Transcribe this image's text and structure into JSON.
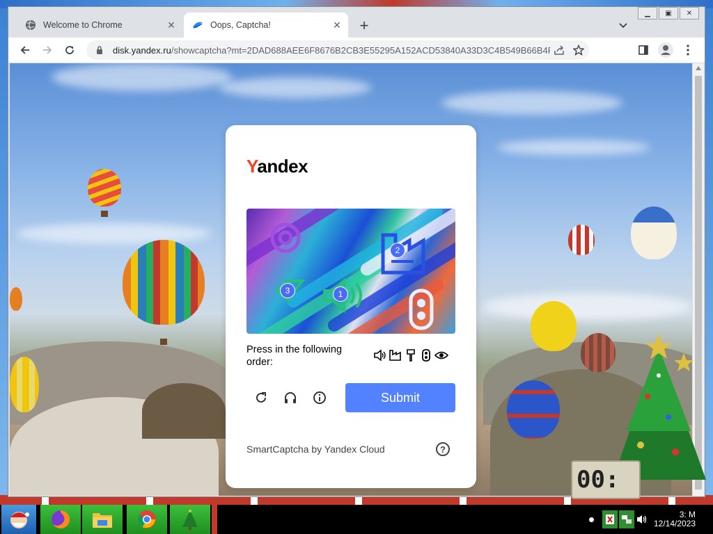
{
  "browser": {
    "tabs": [
      {
        "title": "Welcome to Chrome",
        "active": false
      },
      {
        "title": "Oops, Captcha!",
        "active": true
      }
    ],
    "address": {
      "host": "disk.yandex.ru",
      "path": "/showcaptcha?mt=2DAD688AEE6F8676B2CB3E55295A152ACD53840A33D3C4B549B66B4F07..."
    }
  },
  "captcha": {
    "logo_first": "Y",
    "logo_rest": "andex",
    "instruction": "Press in the following order:",
    "order_icons": [
      "speaker-icon",
      "factory-icon",
      "paintbrush-icon",
      "traffic-light-icon",
      "eye-icon"
    ],
    "puzzle_badges": [
      "1",
      "2",
      "3"
    ],
    "submit_label": "Submit",
    "footer": "SmartCaptcha by Yandex Cloud",
    "help_label": "?"
  },
  "desktop": {
    "clock_display": "00:",
    "tray_time": "3:  M",
    "tray_date": "12/14/2023"
  }
}
